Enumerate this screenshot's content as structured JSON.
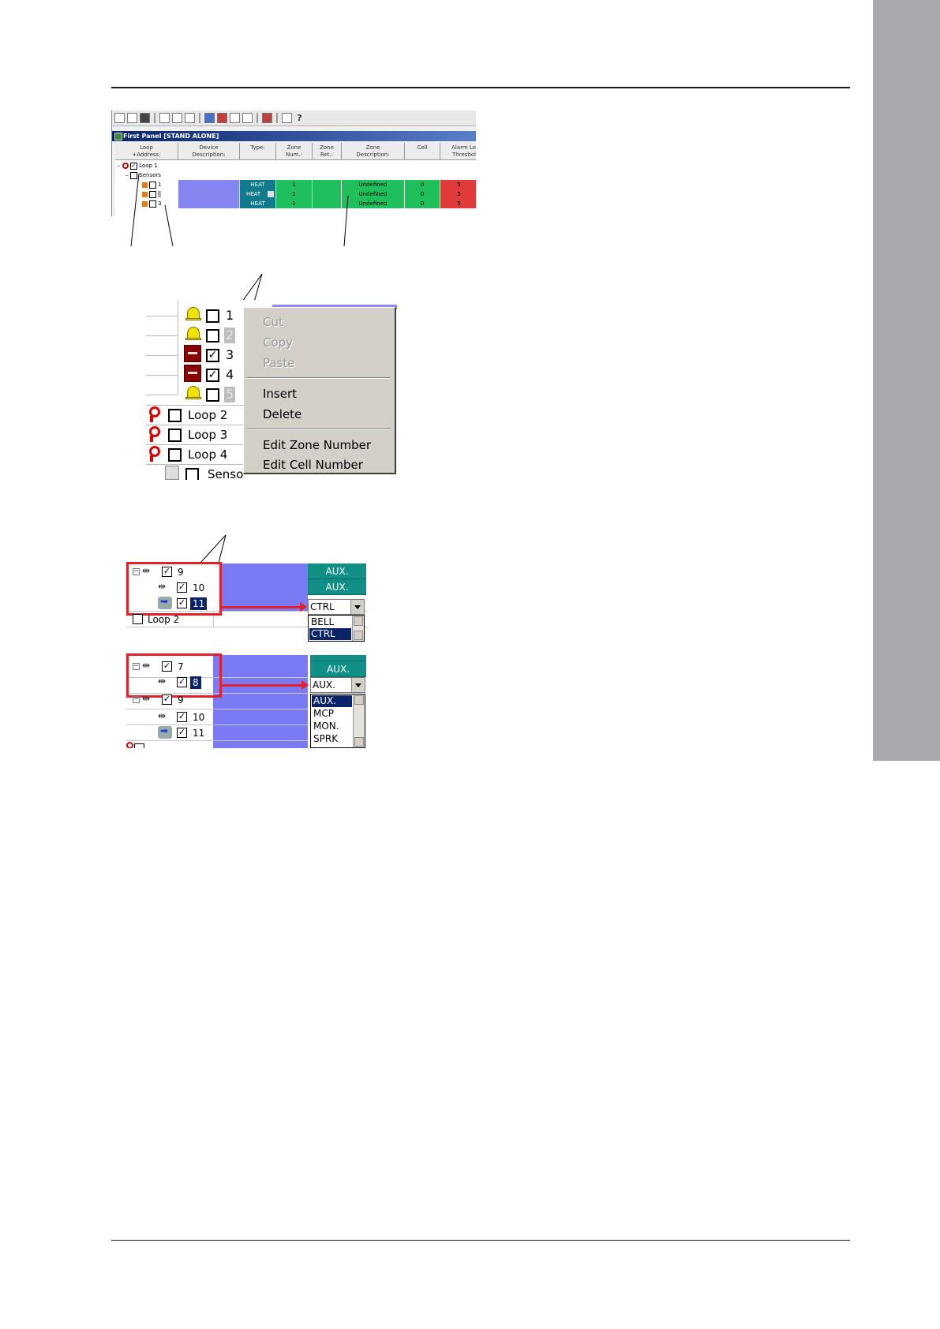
{
  "figure1": {
    "window_title": "First Panel [STAND ALONE]",
    "columns": [
      {
        "label": "Loop\n+Address:"
      },
      {
        "label": "Device\nDescription:"
      },
      {
        "label": "Type:"
      },
      {
        "label": "Zone\nNum.:"
      },
      {
        "label": "Zone\nRet.:"
      },
      {
        "label": "Zone\nDescription:"
      },
      {
        "label": "Cell"
      },
      {
        "label": "Alarm Le\nThreshol"
      }
    ],
    "tree": {
      "loop": "Loop 1",
      "group": "Sensors"
    },
    "rows": [
      {
        "address": "1",
        "type": "HEAT",
        "zone_num": "1",
        "zone_desc": "Undefined",
        "cell": "0",
        "threshold": "5"
      },
      {
        "address": "2",
        "type": "HEAT",
        "zone_num": "1",
        "zone_desc": "Undefined",
        "cell": "0",
        "threshold": "5"
      },
      {
        "address": "3",
        "type": "HEAT",
        "zone_num": "1",
        "zone_desc": "Undefined",
        "cell": "0",
        "threshold": "5"
      }
    ],
    "colors": {
      "type_cell": "#117a8b",
      "zone_cell": "#1fbf5b",
      "threshold_cell": "#e03a3a",
      "desc_cell": "#8585f0"
    }
  },
  "figure2": {
    "devices": [
      {
        "num": "1",
        "kind": "bell",
        "checked": false
      },
      {
        "num": "2",
        "kind": "bell",
        "checked": false
      },
      {
        "num": "3",
        "kind": "module",
        "checked": true
      },
      {
        "num": "4",
        "kind": "module",
        "checked": true
      },
      {
        "num": "5",
        "kind": "bell",
        "checked": false
      }
    ],
    "loops": [
      "Loop 2",
      "Loop 3",
      "Loop 4"
    ],
    "partial": "Senso",
    "menu": {
      "cut": "Cut",
      "copy": "Copy",
      "paste": "Paste",
      "insert": "Insert",
      "delete": "Delete",
      "edit_zone": "Edit Zone Number",
      "edit_cell": "Edit Cell Number"
    }
  },
  "figure3": {
    "top": {
      "nodes": [
        "9",
        "10",
        "11"
      ],
      "type_values": [
        "AUX.",
        "AUX."
      ],
      "combo_value": "CTRL",
      "loop_label": "Loop 2",
      "options": [
        "BELL",
        "CTRL"
      ],
      "selected_option": "CTRL"
    },
    "bottom": {
      "nodes": [
        "7",
        "8",
        "9",
        "10",
        "11"
      ],
      "type_value": "AUX.",
      "combo_value": "AUX.",
      "options": [
        "AUX.",
        "MCP",
        "MON.",
        "SPRK"
      ],
      "selected_option": "AUX."
    }
  }
}
